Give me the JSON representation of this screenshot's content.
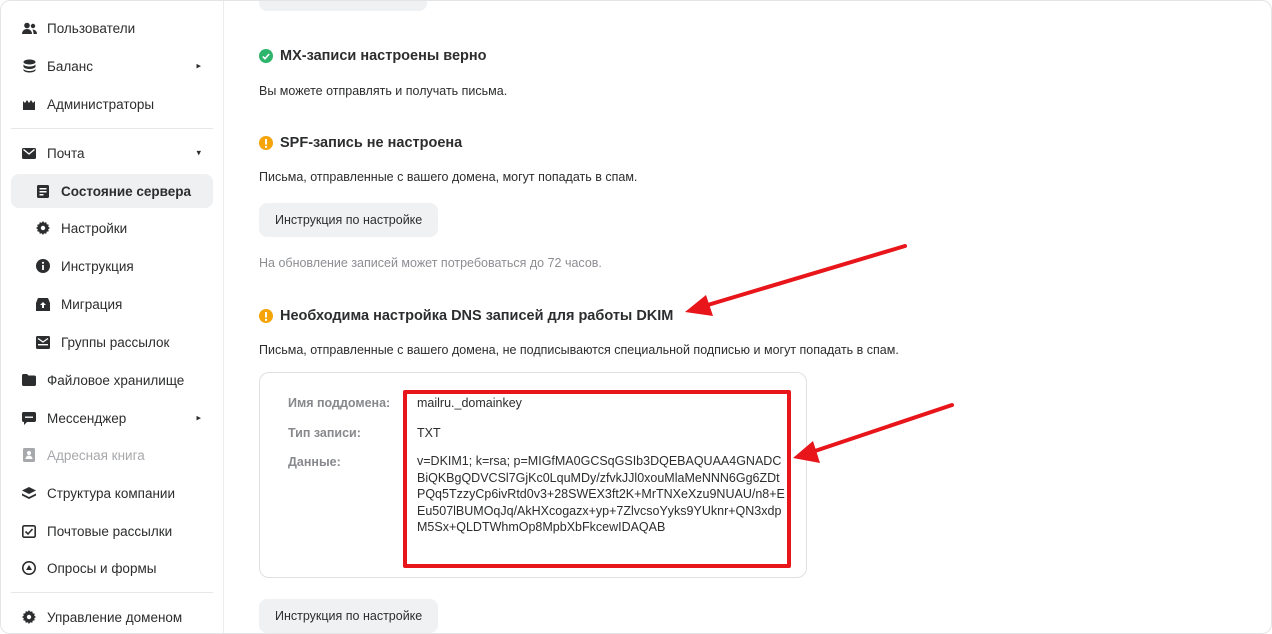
{
  "sidebar": {
    "items": [
      {
        "label": "Пользователи",
        "icon": "users-icon"
      },
      {
        "label": "Баланс",
        "icon": "coins-icon",
        "caret": "▸"
      },
      {
        "label": "Администраторы",
        "icon": "admins-icon"
      },
      {
        "label": "Почта",
        "icon": "mail-icon",
        "caret": "▾"
      },
      {
        "label": "Состояние сервера",
        "icon": "server-status-icon",
        "active": true
      },
      {
        "label": "Настройки",
        "icon": "gear-icon"
      },
      {
        "label": "Инструкция",
        "icon": "info-icon"
      },
      {
        "label": "Миграция",
        "icon": "migration-icon"
      },
      {
        "label": "Группы рассылок",
        "icon": "mailing-groups-icon"
      },
      {
        "label": "Файловое хранилище",
        "icon": "folder-icon"
      },
      {
        "label": "Мессенджер",
        "icon": "messenger-icon",
        "caret": "▸"
      },
      {
        "label": "Адресная книга",
        "icon": "address-book-icon",
        "disabled": true
      },
      {
        "label": "Структура компании",
        "icon": "structure-icon"
      },
      {
        "label": "Почтовые рассылки",
        "icon": "newsletter-icon"
      },
      {
        "label": "Опросы и формы",
        "icon": "forms-icon"
      },
      {
        "label": "Управление доменом",
        "icon": "gear-icon"
      }
    ]
  },
  "mx": {
    "title": "MX-записи настроены верно",
    "desc": "Вы можете отправлять и получать письма."
  },
  "spf": {
    "title": "SPF-запись не настроена",
    "desc": "Письма, отправленные с вашего домена, могут попадать в спам.",
    "button": "Инструкция по настройке",
    "hint": "На обновление записей может потребоваться до 72 часов."
  },
  "dkim": {
    "title": "Необходима настройка DNS записей для работы DKIM",
    "desc": "Письма, отправленные с вашего домена, не подписываются специальной подписью и могут попадать в спам.",
    "subdomain_label": "Имя поддомена:",
    "subdomain_value": "mailru._domainkey",
    "type_label": "Тип записи:",
    "type_value": "TXT",
    "data_label": "Данные:",
    "data_value": "v=DKIM1; k=rsa; p=MIGfMA0GCSqGSIb3DQEBAQUAA4GNADCBiQKBgQDVCSl7GjKc0LquMDy/zfvkJJl0xouMlaMeNNN6Gg6ZDtPQq5TzzyCp6ivRtd0v3+28SWEX3ft2K+MrTNXeXzu9NUAU/n8+EEu507lBUMOqJq/AkHXcogazx+yp+7ZlvcsoYyks9YUknr+QN3xdpM5Sx+QLDTWhmOp8MpbXbFkcewIDAQAB",
    "button": "Инструкция по настройке"
  },
  "colors": {
    "ok": "#2db56b",
    "warn": "#f5a40a",
    "annotation": "#e8151b"
  }
}
